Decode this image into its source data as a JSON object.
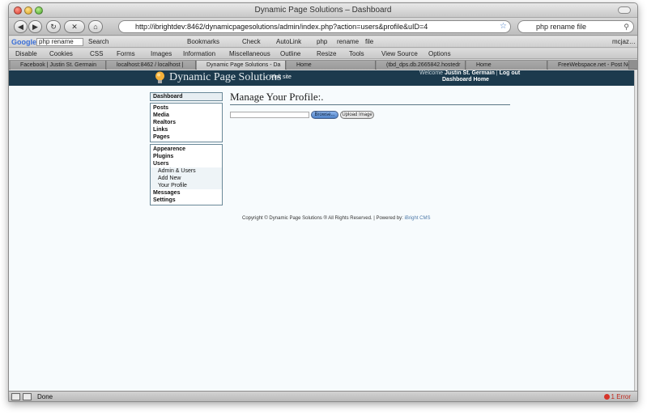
{
  "window": {
    "title": "Dynamic Page Solutions – Dashboard"
  },
  "nav": {
    "url": "http://ibrightdev:8462/dynamicpagesolutions/admin/index.php?action=users&profile&uID=4",
    "search_value": "php rename file"
  },
  "google_toolbar": {
    "logo": "Google",
    "query": "php rename",
    "items": [
      "Search",
      "Bookmarks",
      "Check",
      "AutoLink",
      "php",
      "rename",
      "file"
    ],
    "account": "mcjaz…"
  },
  "dev_toolbar": {
    "items": [
      "Disable",
      "Cookies",
      "CSS",
      "Forms",
      "Images",
      "Information",
      "Miscellaneous",
      "Outline",
      "Resize",
      "Tools",
      "View Source",
      "Options"
    ]
  },
  "tabs": [
    {
      "label": "Facebook | Justin St. Germain"
    },
    {
      "label": "localhost:8462 / localhost |"
    },
    {
      "label": "Dynamic Page Solutions - Da"
    },
    {
      "label": "Home"
    },
    {
      "label": "(tbd_dps.db.2665842.hostedr"
    },
    {
      "label": "Home"
    },
    {
      "label": "FreeWebspace.net - Post Ne"
    }
  ],
  "site": {
    "name": "Dynamic Page Solutions",
    "visit_link": "← Visit site",
    "welcome_prefix": "Welcome",
    "user_name": "Justin St. Germain",
    "logout": "Log out",
    "dashboard_home": "Dashboard Home"
  },
  "sidebar": {
    "dashboard": "Dashboard",
    "group1": [
      "Posts",
      "Media",
      "Realtors",
      "Links",
      "Pages"
    ],
    "group2": {
      "appearance": "Appearence",
      "plugins": "Plugins",
      "users": "Users",
      "users_sub": [
        "Admin & Users",
        "Add New",
        "Your Profile"
      ],
      "messages": "Messages",
      "settings": "Settings"
    }
  },
  "main": {
    "title": "Manage Your Profile:.",
    "browse_label": "Browse...",
    "upload_label": "Upload Image"
  },
  "footer": {
    "copyright": "Copyright © Dynamic Page Solutions ® All Rights Reserved. | Powered by:",
    "brand": "iBright CMS"
  },
  "status": {
    "text": "Done",
    "errors": "1 Error"
  },
  "colors": {
    "header_bg": "#1c3a4d",
    "content_bg": "#f7fbfd",
    "sidebar_border": "#6a8898",
    "browse_blue": "#4d80c6"
  }
}
